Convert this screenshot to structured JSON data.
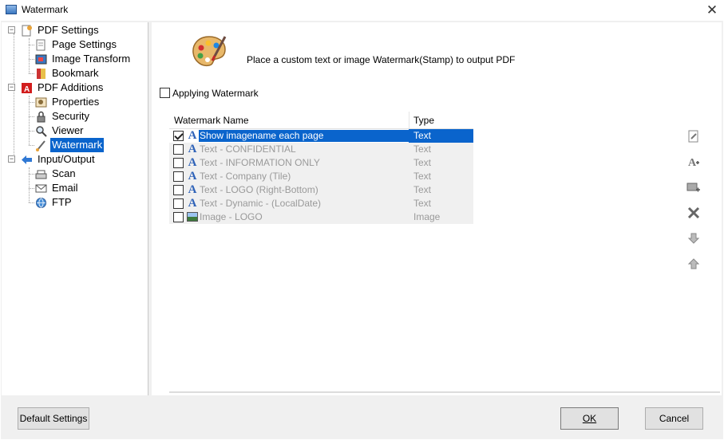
{
  "window": {
    "title": "Watermark",
    "close_label": "✕"
  },
  "tree": {
    "groups": [
      {
        "label": "PDF Settings",
        "icon": "document-gear-icon",
        "expanded": true,
        "children": [
          {
            "label": "Page Settings",
            "icon": "page-settings-icon"
          },
          {
            "label": "Image Transform",
            "icon": "image-transform-icon"
          },
          {
            "label": "Bookmark",
            "icon": "bookmark-icon"
          }
        ]
      },
      {
        "label": "PDF Additions",
        "icon": "pdf-icon",
        "expanded": true,
        "children": [
          {
            "label": "Properties",
            "icon": "properties-icon"
          },
          {
            "label": "Security",
            "icon": "lock-icon"
          },
          {
            "label": "Viewer",
            "icon": "magnifier-icon"
          },
          {
            "label": "Watermark",
            "icon": "brush-icon",
            "selected": true
          }
        ]
      },
      {
        "label": "Input/Output",
        "icon": "arrow-left-icon",
        "expanded": true,
        "children": [
          {
            "label": "Scan",
            "icon": "scanner-icon"
          },
          {
            "label": "Email",
            "icon": "email-icon"
          },
          {
            "label": "FTP",
            "icon": "ftp-icon"
          }
        ]
      }
    ]
  },
  "main": {
    "header_text": "Place a custom text or image Watermark(Stamp) to output PDF",
    "apply_label": "Applying Watermark",
    "apply_checked": false,
    "columns": [
      "Watermark Name",
      "Type"
    ],
    "rows": [
      {
        "name": "Show imagename each page",
        "type": "Text",
        "checked": true,
        "selected": true,
        "kind": "text"
      },
      {
        "name": "Text - CONFIDENTIAL",
        "type": "Text",
        "checked": false,
        "kind": "text"
      },
      {
        "name": "Text - INFORMATION ONLY",
        "type": "Text",
        "checked": false,
        "kind": "text"
      },
      {
        "name": "Text - Company (Tile)",
        "type": "Text",
        "checked": false,
        "kind": "text"
      },
      {
        "name": "Text - LOGO (Right-Bottom)",
        "type": "Text",
        "checked": false,
        "kind": "text"
      },
      {
        "name": "Text - Dynamic - (LocalDate)",
        "type": "Text",
        "checked": false,
        "kind": "text"
      },
      {
        "name": "Image - LOGO",
        "type": "Image",
        "checked": false,
        "kind": "image"
      }
    ]
  },
  "tools": [
    "edit-icon",
    "add-text-icon",
    "add-image-icon",
    "delete-icon",
    "move-down-icon",
    "move-up-icon"
  ],
  "buttons": {
    "default_settings": "Default Settings",
    "ok": "OK",
    "cancel": "Cancel"
  },
  "colors": {
    "selection": "#0a64cc",
    "text_icon": "#2f63b8"
  }
}
